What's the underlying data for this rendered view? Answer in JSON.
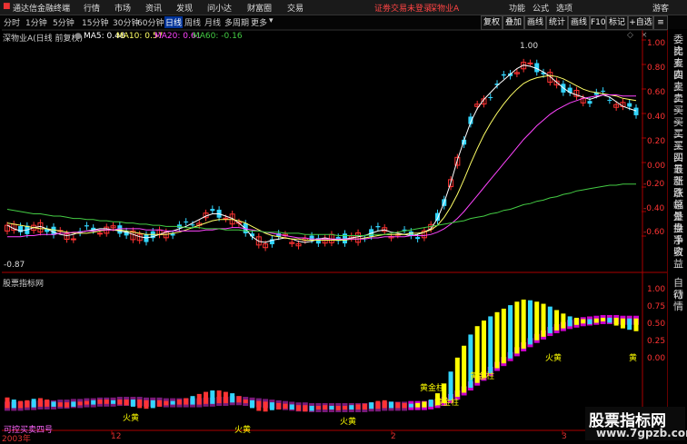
{
  "window": {
    "app_title": "通达信金融终端",
    "menu": [
      "行情",
      "市场",
      "资讯",
      "发现",
      "问小达",
      "财富圈",
      "交易"
    ],
    "status_text": "证劵交易未登录",
    "stock_name": "深物业A",
    "right_menu": [
      "功能",
      "公式",
      "选项"
    ],
    "user": "游客"
  },
  "toolbar": {
    "periods": [
      "分时",
      "1分钟",
      "5分钟",
      "15分钟",
      "30分钟",
      "60分钟",
      "日线",
      "周线",
      "月线",
      "多周期",
      "更多"
    ],
    "active_period": "日线",
    "buttons": [
      "复权",
      "叠加",
      "画线",
      "统计",
      "画线",
      "F10",
      "标记",
      "+自选"
    ]
  },
  "main_chart": {
    "title": "深物业A(日线 前复权)",
    "ma": [
      {
        "label": "MA5: 0.48",
        "color": "#ffffff"
      },
      {
        "label": "MA10: 0.57",
        "color": "#ffff66"
      },
      {
        "label": "MA20: 0.61",
        "color": "#ff44ff"
      },
      {
        "label": "MA60: -0.16",
        "color": "#44cc44"
      }
    ],
    "y_ticks": [
      "1.00",
      "0.80",
      "0.60",
      "0.40",
      "0.20",
      "0.00",
      "-0.20",
      "-0.40",
      "-0.60"
    ],
    "high_label": "1.00",
    "low_label": "-0.87"
  },
  "indicator": {
    "name": "股票指标网",
    "y_ticks": [
      "1.00",
      "0.75",
      "0.50",
      "0.25",
      "0.00"
    ],
    "annotations": [
      "黄金柱",
      "黄金柱",
      "黄金柱",
      "火黄",
      "火黄",
      "火黄",
      "火黄",
      "黄"
    ],
    "bottom_label": "可控买卖四号"
  },
  "x_axis": {
    "labels": [
      "2003年",
      "12",
      "2",
      "3"
    ]
  },
  "right_panel": {
    "items": [
      "委比",
      "卖五",
      "卖四",
      "卖三",
      "卖二",
      "卖一",
      "买一",
      "买二",
      "买三",
      "买四",
      "买五",
      "最新",
      "涨跌",
      "涨幅",
      "总量",
      "外盘",
      "换手",
      "净资",
      "收益",
      "自动",
      "行情"
    ]
  },
  "watermark": {
    "line1": "股票指标网",
    "line2": "www.7gpzb.com"
  },
  "colors": {
    "up": "#ff3333",
    "down": "#33d6ff",
    "grid": "#550000",
    "axis": "#aa0000",
    "ma60": "#44cc44"
  },
  "chart_data": {
    "type": "candlestick",
    "series": [
      {
        "name": "MA5",
        "values": [
          -0.52,
          -0.55,
          -0.57,
          -0.56,
          -0.54,
          -0.53,
          -0.55,
          -0.58,
          -0.6,
          -0.61,
          -0.6,
          -0.58,
          -0.57,
          -0.56,
          -0.55,
          -0.55,
          -0.56,
          -0.57,
          -0.58,
          -0.6,
          -0.62,
          -0.63,
          -0.62,
          -0.6,
          -0.58,
          -0.57,
          -0.55,
          -0.53,
          -0.5,
          -0.47,
          -0.44,
          -0.42,
          -0.42,
          -0.44,
          -0.46,
          -0.5,
          -0.55,
          -0.62,
          -0.66,
          -0.67,
          -0.65,
          -0.64,
          -0.63,
          -0.64,
          -0.66,
          -0.67,
          -0.66,
          -0.64,
          -0.63,
          -0.64,
          -0.65,
          -0.64,
          -0.63,
          -0.62,
          -0.61,
          -0.59,
          -0.57,
          -0.56,
          -0.58,
          -0.59,
          -0.6,
          -0.61,
          -0.6,
          -0.58,
          -0.55,
          -0.46,
          -0.32,
          -0.15,
          0.05,
          0.22,
          0.38,
          0.5,
          0.58,
          0.64,
          0.7,
          0.75,
          0.8,
          0.85,
          0.88,
          0.87,
          0.85,
          0.82,
          0.78,
          0.73,
          0.68,
          0.64,
          0.62,
          0.6,
          0.58,
          0.6,
          0.62,
          0.6,
          0.56,
          0.52,
          0.5,
          0.48
        ]
      },
      {
        "name": "MA10",
        "values": [
          -0.5,
          -0.51,
          -0.52,
          -0.53,
          -0.54,
          -0.55,
          -0.55,
          -0.56,
          -0.57,
          -0.58,
          -0.59,
          -0.59,
          -0.59,
          -0.58,
          -0.57,
          -0.56,
          -0.56,
          -0.56,
          -0.57,
          -0.58,
          -0.59,
          -0.6,
          -0.6,
          -0.6,
          -0.6,
          -0.59,
          -0.58,
          -0.56,
          -0.54,
          -0.52,
          -0.5,
          -0.48,
          -0.47,
          -0.47,
          -0.47,
          -0.48,
          -0.5,
          -0.53,
          -0.56,
          -0.59,
          -0.61,
          -0.62,
          -0.63,
          -0.64,
          -0.64,
          -0.65,
          -0.65,
          -0.65,
          -0.65,
          -0.65,
          -0.65,
          -0.65,
          -0.64,
          -0.64,
          -0.63,
          -0.62,
          -0.61,
          -0.6,
          -0.6,
          -0.6,
          -0.6,
          -0.59,
          -0.59,
          -0.58,
          -0.56,
          -0.52,
          -0.45,
          -0.36,
          -0.25,
          -0.12,
          0.02,
          0.15,
          0.27,
          0.37,
          0.46,
          0.54,
          0.61,
          0.67,
          0.72,
          0.75,
          0.77,
          0.78,
          0.79,
          0.78,
          0.76,
          0.73,
          0.7,
          0.67,
          0.65,
          0.64,
          0.63,
          0.62,
          0.61,
          0.59,
          0.58,
          0.57
        ]
      },
      {
        "name": "MA20",
        "values": [
          -0.62,
          -0.62,
          -0.62,
          -0.61,
          -0.61,
          -0.6,
          -0.6,
          -0.6,
          -0.59,
          -0.59,
          -0.58,
          -0.58,
          -0.57,
          -0.57,
          -0.56,
          -0.56,
          -0.56,
          -0.55,
          -0.55,
          -0.55,
          -0.55,
          -0.56,
          -0.56,
          -0.56,
          -0.57,
          -0.57,
          -0.57,
          -0.57,
          -0.57,
          -0.57,
          -0.56,
          -0.56,
          -0.55,
          -0.55,
          -0.54,
          -0.54,
          -0.55,
          -0.56,
          -0.57,
          -0.58,
          -0.59,
          -0.6,
          -0.61,
          -0.62,
          -0.63,
          -0.63,
          -0.64,
          -0.64,
          -0.64,
          -0.64,
          -0.64,
          -0.64,
          -0.64,
          -0.64,
          -0.64,
          -0.63,
          -0.63,
          -0.62,
          -0.62,
          -0.62,
          -0.62,
          -0.61,
          -0.61,
          -0.61,
          -0.6,
          -0.58,
          -0.55,
          -0.51,
          -0.46,
          -0.4,
          -0.33,
          -0.26,
          -0.19,
          -0.12,
          -0.05,
          0.02,
          0.09,
          0.16,
          0.23,
          0.29,
          0.35,
          0.4,
          0.45,
          0.49,
          0.52,
          0.55,
          0.57,
          0.59,
          0.6,
          0.61,
          0.62,
          0.62,
          0.62,
          0.61,
          0.61,
          0.61
        ]
      },
      {
        "name": "MA60",
        "values": [
          -0.38,
          -0.39,
          -0.4,
          -0.41,
          -0.42,
          -0.42,
          -0.43,
          -0.44,
          -0.44,
          -0.45,
          -0.46,
          -0.46,
          -0.47,
          -0.47,
          -0.48,
          -0.48,
          -0.49,
          -0.49,
          -0.5,
          -0.5,
          -0.51,
          -0.51,
          -0.52,
          -0.52,
          -0.53,
          -0.53,
          -0.53,
          -0.54,
          -0.54,
          -0.54,
          -0.55,
          -0.55,
          -0.55,
          -0.56,
          -0.56,
          -0.56,
          -0.57,
          -0.57,
          -0.57,
          -0.58,
          -0.58,
          -0.58,
          -0.59,
          -0.59,
          -0.59,
          -0.6,
          -0.6,
          -0.6,
          -0.6,
          -0.6,
          -0.61,
          -0.61,
          -0.61,
          -0.61,
          -0.61,
          -0.6,
          -0.6,
          -0.6,
          -0.59,
          -0.58,
          -0.57,
          -0.56,
          -0.55,
          -0.54,
          -0.53,
          -0.52,
          -0.51,
          -0.5,
          -0.49,
          -0.48,
          -0.46,
          -0.45,
          -0.44,
          -0.42,
          -0.41,
          -0.39,
          -0.38,
          -0.36,
          -0.34,
          -0.33,
          -0.31,
          -0.3,
          -0.28,
          -0.27,
          -0.25,
          -0.24,
          -0.22,
          -0.21,
          -0.2,
          -0.19,
          -0.18,
          -0.17,
          -0.17,
          -0.16,
          -0.16,
          -0.16
        ]
      }
    ],
    "ylim": [
      -0.9,
      1.1
    ]
  }
}
